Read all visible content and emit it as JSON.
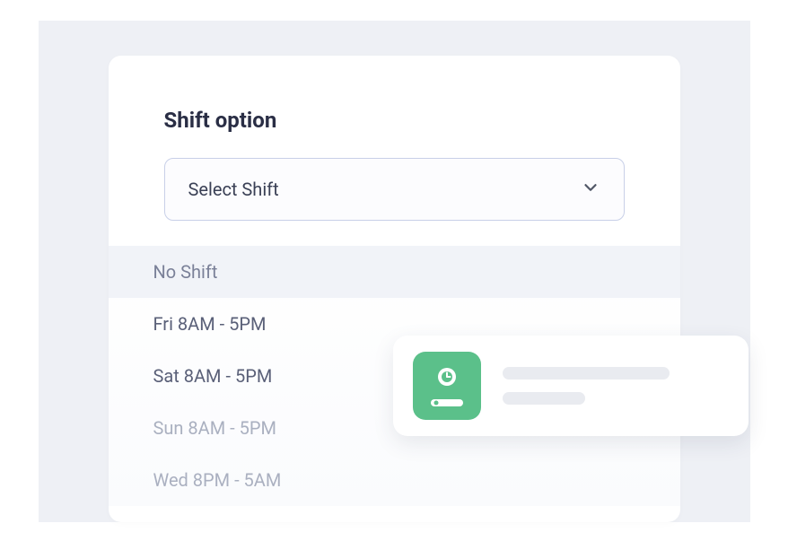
{
  "heading": "Shift option",
  "select": {
    "placeholder": "Select Shift"
  },
  "options": [
    {
      "label": "No Shift",
      "state": "highlighted"
    },
    {
      "label": "Fri 8AM - 5PM",
      "state": "normal"
    },
    {
      "label": "Sat 8AM - 5PM",
      "state": "normal"
    },
    {
      "label": "Sun 8AM - 5PM",
      "state": "faded"
    },
    {
      "label": "Wed 8PM - 5AM",
      "state": "faded"
    }
  ],
  "colors": {
    "accent_green": "#5bc08a",
    "border": "#c8d0e8",
    "text_dark": "#2a2e45",
    "text_muted": "#aab0c0"
  }
}
